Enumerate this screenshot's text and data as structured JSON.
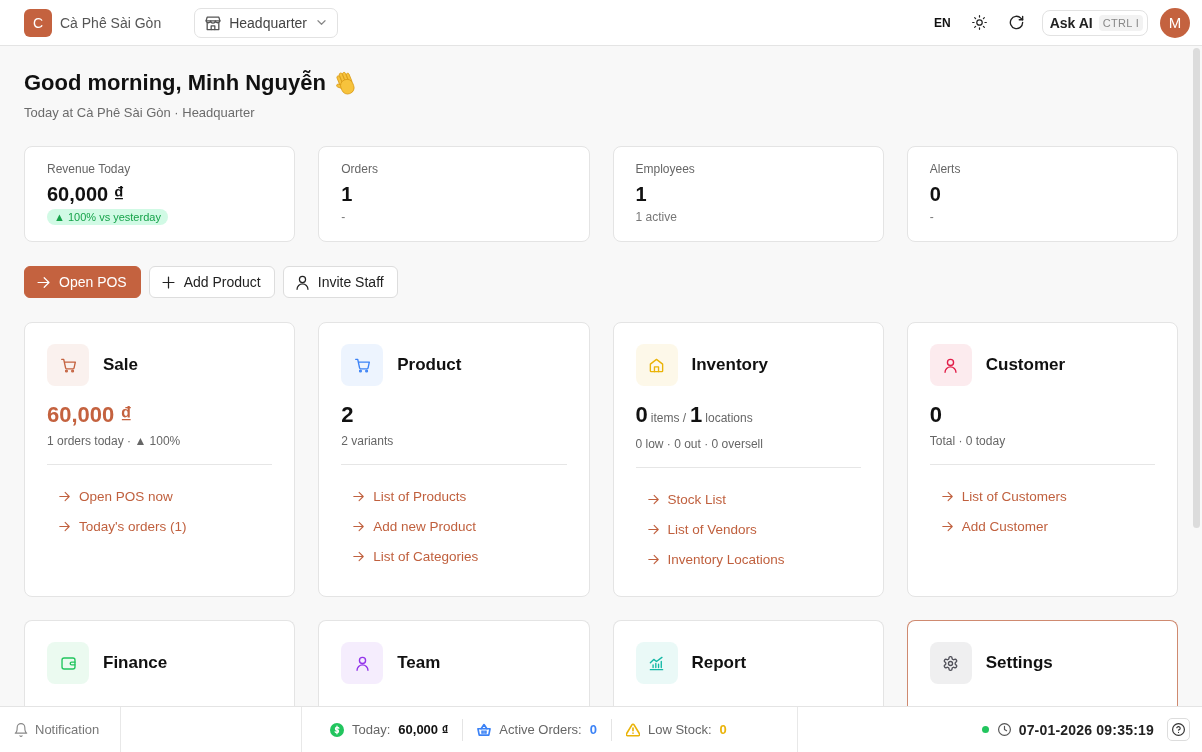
{
  "top_bar": {
    "brand": {
      "initial": "C",
      "name": "Cà Phê Sài Gòn"
    },
    "branch_selector": {
      "value": "Headquarter"
    },
    "language": "EN",
    "ask_ai": {
      "label": "Ask AI",
      "shortcut": "CTRL I"
    },
    "avatar": {
      "initial": "M"
    }
  },
  "greeting": {
    "title": "Good morning, Minh Nguyễn",
    "subtitle": "Today at Cà Phê Sài Gòn · Headquarter"
  },
  "stats": [
    {
      "label": "Revenue Today",
      "value": "60,000 ₫",
      "sub": {
        "kind": "badge",
        "text": "▲ 100% vs yesterday"
      }
    },
    {
      "label": "Orders",
      "value": "1",
      "sub": {
        "kind": "text",
        "text": "-"
      }
    },
    {
      "label": "Employees",
      "value": "1",
      "sub": {
        "kind": "text",
        "text": "1 active"
      }
    },
    {
      "label": "Alerts",
      "value": "0",
      "sub": {
        "kind": "text",
        "text": "-"
      }
    }
  ],
  "actions": [
    {
      "label": "Open POS",
      "kind": "primary"
    },
    {
      "label": "Add Product",
      "kind": "secondary"
    },
    {
      "label": "Invite Staff",
      "kind": "secondary"
    }
  ],
  "modules": [
    {
      "title": "Sale",
      "color": "#c4623f",
      "highlighted": false,
      "value_accent": true,
      "value": [
        {
          "kind": "number",
          "text": "60,000 ₫"
        }
      ],
      "sub": "1 orders today · ▲ 100%",
      "links": [
        "Open POS now",
        "Today's orders (1)"
      ]
    },
    {
      "title": "Product",
      "color": "#3b82f6",
      "highlighted": false,
      "value_accent": false,
      "value": [
        {
          "kind": "number",
          "text": "2"
        }
      ],
      "sub": "2 variants",
      "links": [
        "List of Products",
        "Add new Product",
        "List of Categories"
      ]
    },
    {
      "title": "Inventory",
      "color": "#eab308",
      "highlighted": false,
      "value_accent": false,
      "value": [
        {
          "kind": "number",
          "text": "0"
        },
        {
          "kind": "unit",
          "text": "items /"
        },
        {
          "kind": "number",
          "text": "1"
        },
        {
          "kind": "unit",
          "text": "locations"
        }
      ],
      "sub": "0 low · 0 out · 0 oversell",
      "links": [
        "Stock List",
        "List of Vendors",
        "Inventory Locations"
      ]
    },
    {
      "title": "Customer",
      "color": "#e11d48",
      "highlighted": false,
      "value_accent": false,
      "value": [
        {
          "kind": "number",
          "text": "0"
        }
      ],
      "sub": "Total · 0 today",
      "links": [
        "List of Customers",
        "Add Customer"
      ]
    },
    {
      "title": "Finance",
      "color": "#22c55e",
      "highlighted": false
    },
    {
      "title": "Team",
      "color": "#9333ea",
      "highlighted": false
    },
    {
      "title": "Report",
      "color": "#14b8a6",
      "highlighted": false
    },
    {
      "title": "Settings",
      "color": "#52525b",
      "highlighted": true
    }
  ],
  "status_bar": {
    "notification": "Notification",
    "metrics": [
      {
        "label": "Today:",
        "value": "60,000 ₫",
        "color": "#22c55e",
        "value_tinted": false
      },
      {
        "label": "Active Orders:",
        "value": "0",
        "color": "#3b82f6",
        "value_tinted": true
      },
      {
        "label": "Low Stock:",
        "value": "0",
        "color": "#eab308",
        "value_tinted": true
      }
    ],
    "connected": true,
    "datetime": "07-01-2026 09:35:19"
  }
}
